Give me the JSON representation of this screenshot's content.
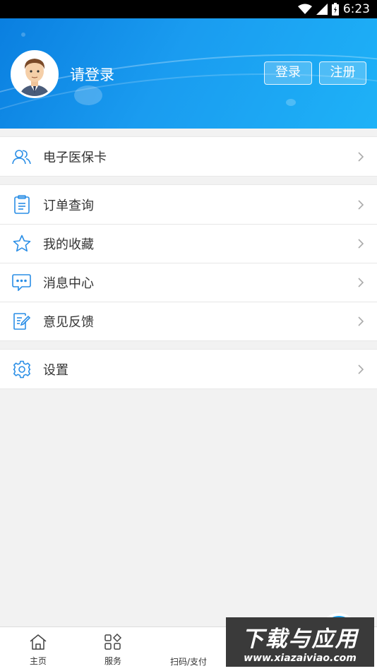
{
  "status_bar": {
    "time": "6:23"
  },
  "header": {
    "login_prompt": "请登录",
    "login_button": "登录",
    "register_button": "注册"
  },
  "menu_groups": [
    {
      "items": [
        {
          "label": "电子医保卡",
          "icon": "people-icon"
        }
      ]
    },
    {
      "items": [
        {
          "label": "订单查询",
          "icon": "clipboard-icon"
        },
        {
          "label": "我的收藏",
          "icon": "star-icon"
        },
        {
          "label": "消息中心",
          "icon": "chat-bubble-icon"
        },
        {
          "label": "意见反馈",
          "icon": "feedback-edit-icon"
        }
      ]
    },
    {
      "items": [
        {
          "label": "设置",
          "icon": "gear-icon"
        }
      ]
    }
  ],
  "tabbar": {
    "home_label": "主页",
    "service_label": "服务",
    "scan_label": "扫码/支付"
  },
  "watermark": {
    "title": "下载与应用",
    "url": "www.xiazaiviao.com"
  },
  "colors": {
    "accent": "#2a8ee6",
    "header_start": "#0a7fe0",
    "header_end": "#1eb2f7"
  }
}
